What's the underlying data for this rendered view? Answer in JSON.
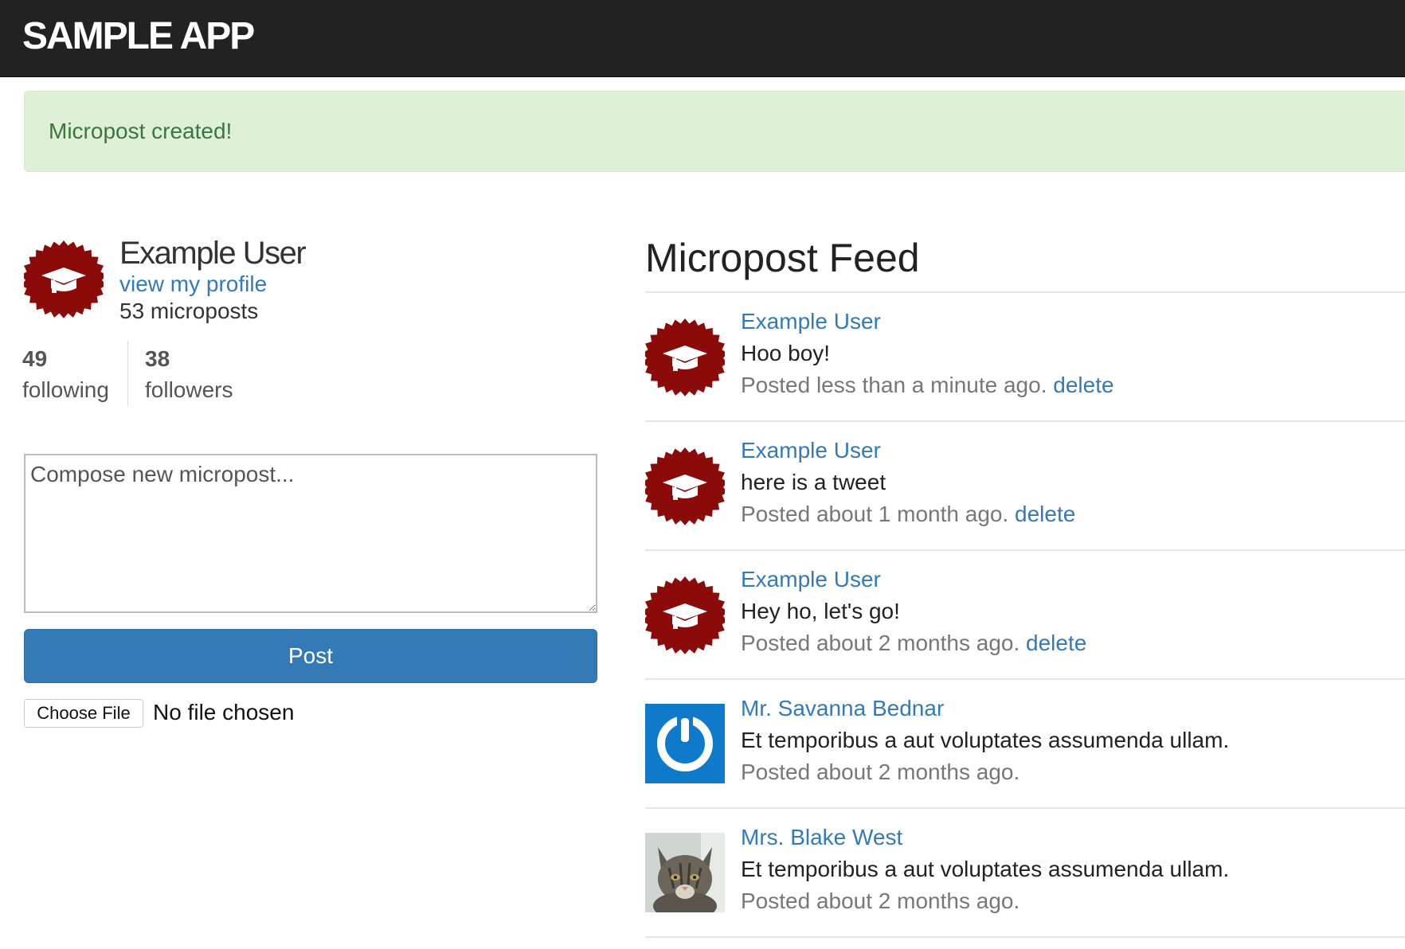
{
  "header": {
    "logo": "SAMPLE APP"
  },
  "flash": {
    "message": "Micropost created!"
  },
  "user_info": {
    "name": "Example User",
    "profile_link": "view my profile",
    "micropost_count": "53 microposts",
    "following_count": "49",
    "following_label": "following",
    "followers_count": "38",
    "followers_label": "followers"
  },
  "compose": {
    "placeholder": "Compose new micropost...",
    "value": "",
    "post_label": "Post",
    "choose_file_label": "Choose File",
    "no_file_text": "No file chosen"
  },
  "feed": {
    "title": "Micropost Feed",
    "items": [
      {
        "user": "Example User",
        "content": "Hoo boy!",
        "time": "Posted less than a minute ago.",
        "delete": "delete",
        "avatar": "graduation-cap-badge-icon"
      },
      {
        "user": "Example User",
        "content": "here is a tweet",
        "time": "Posted about 1 month ago.",
        "delete": "delete",
        "avatar": "graduation-cap-badge-icon"
      },
      {
        "user": "Example User",
        "content": "Hey ho, let's go!",
        "time": "Posted about 2 months ago.",
        "delete": "delete",
        "avatar": "graduation-cap-badge-icon"
      },
      {
        "user": "Mr. Savanna Bednar",
        "content": "Et temporibus a aut voluptates assumenda ullam.",
        "time": "Posted about 2 months ago.",
        "avatar": "power-symbol-icon"
      },
      {
        "user": "Mrs. Blake West",
        "content": "Et temporibus a aut voluptates assumenda ullam.",
        "time": "Posted about 2 months ago.",
        "avatar": "cat-photo-icon"
      }
    ]
  },
  "colors": {
    "navbar": "#222222",
    "flash_bg": "#dff0d8",
    "flash_text": "#3c763d",
    "link": "#337ab7",
    "button": "#337ab7",
    "badge": "#8b0a0a"
  }
}
